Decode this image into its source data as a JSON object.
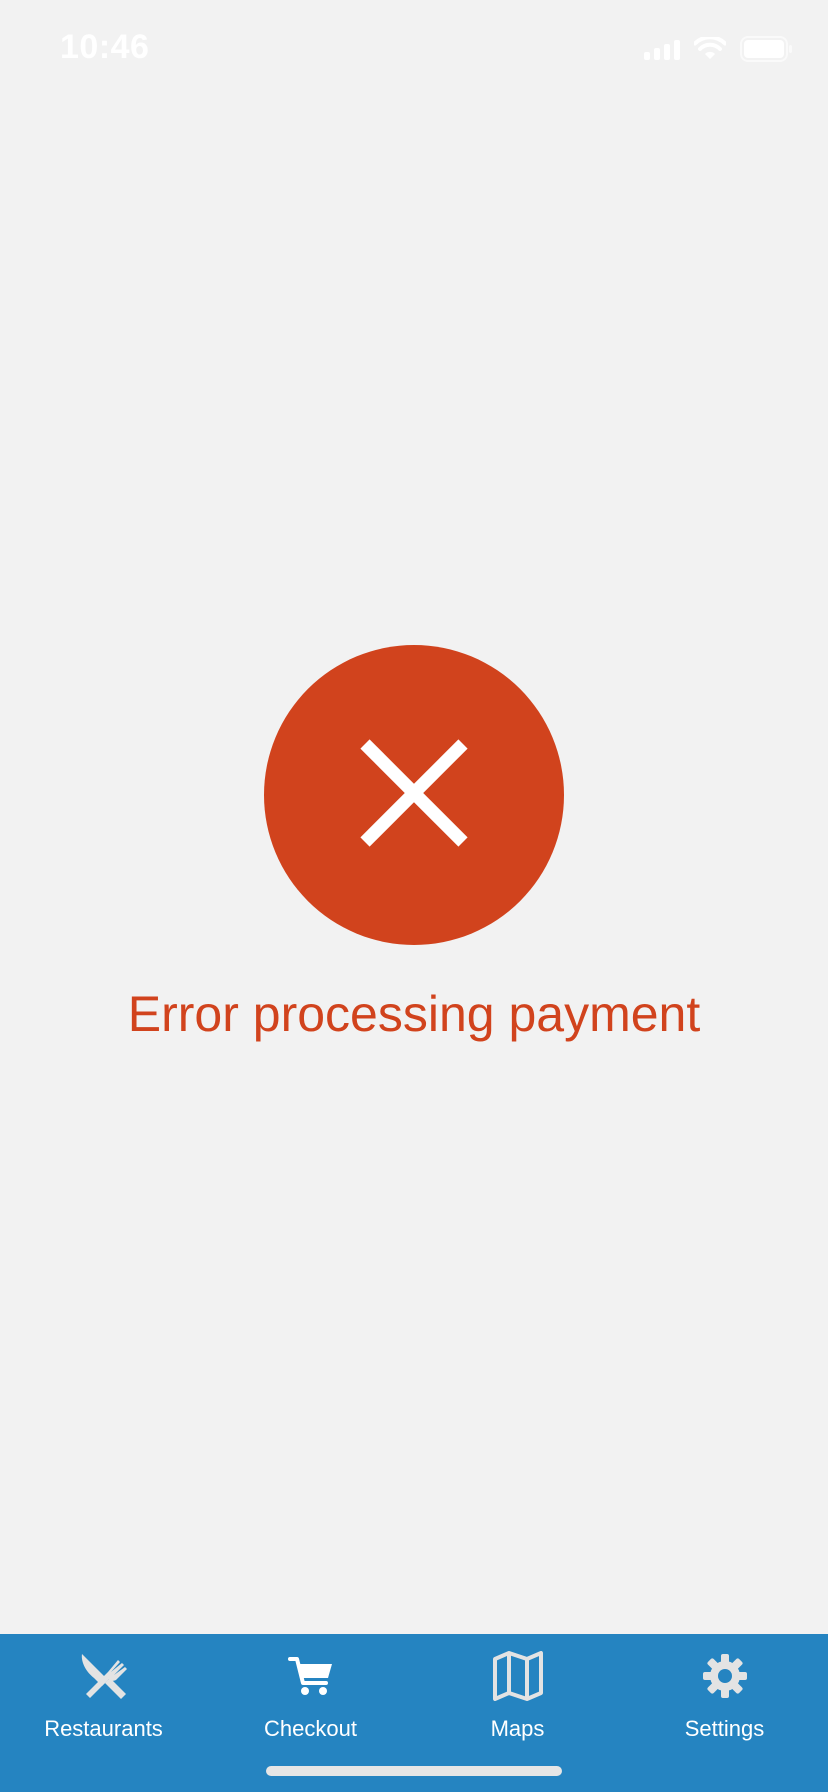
{
  "status_bar": {
    "time": "10:46"
  },
  "error": {
    "icon": "close-icon",
    "message": "Error processing payment",
    "color": "#d1431d"
  },
  "tab_bar": {
    "background": "#2584c1",
    "items": [
      {
        "label": "Restaurants",
        "icon": "fork-knife-icon"
      },
      {
        "label": "Checkout",
        "icon": "cart-icon"
      },
      {
        "label": "Maps",
        "icon": "map-icon"
      },
      {
        "label": "Settings",
        "icon": "gear-icon"
      }
    ]
  }
}
